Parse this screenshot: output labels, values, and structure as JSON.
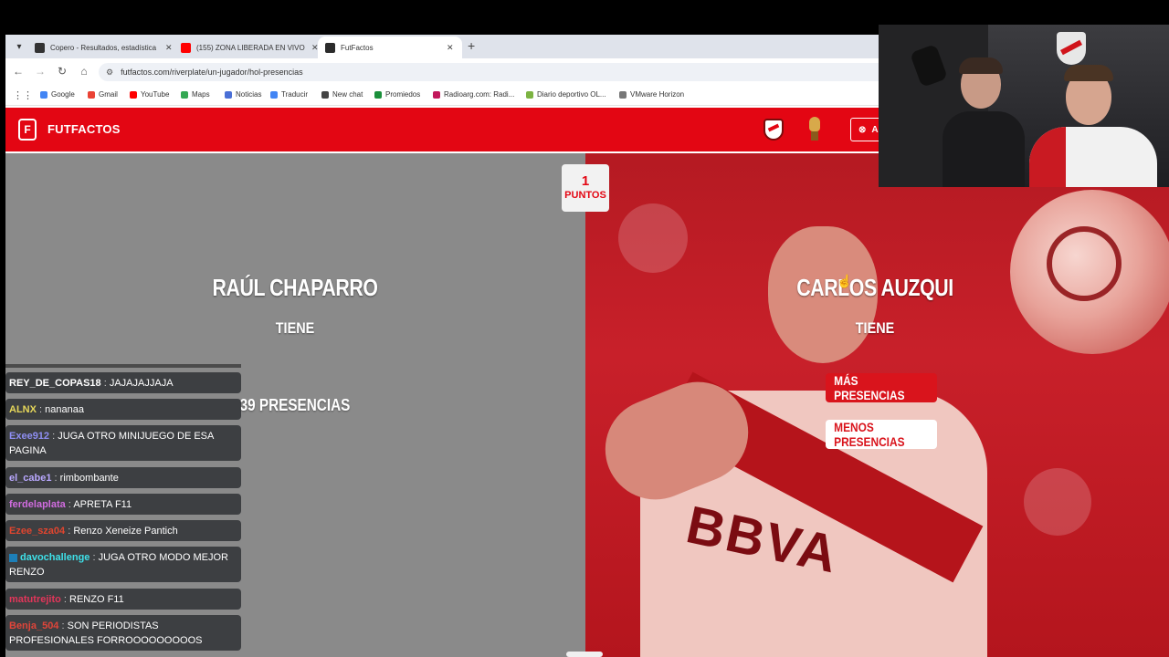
{
  "browser": {
    "tabs": [
      {
        "title": "Copero - Resultados, estadística",
        "fav_color": "#333333"
      },
      {
        "title": "(155) ZONA LIBERADA EN VIVO",
        "fav_color": "#ff0000"
      },
      {
        "title": "FutFactos",
        "fav_color": "#2b2b2b",
        "active": true
      }
    ],
    "url": "futfactos.com/riverplate/un-jugador/hol-presencias",
    "bookmarks": [
      {
        "label": "Google",
        "color": "#4285f4"
      },
      {
        "label": "Gmail",
        "color": "#ea4335"
      },
      {
        "label": "YouTube",
        "color": "#ff0000"
      },
      {
        "label": "Maps",
        "color": "#34a853"
      },
      {
        "label": "Noticias",
        "color": "#4a6fd6"
      },
      {
        "label": "Traducir",
        "color": "#4285f4"
      },
      {
        "label": "New chat",
        "color": "#444444"
      },
      {
        "label": "Promiedos",
        "color": "#1a8f3a"
      },
      {
        "label": "Radioarg.com: Radi...",
        "color": "#c2185b"
      },
      {
        "label": "Diario deportivo OL...",
        "color": "#7cb342"
      },
      {
        "label": "VMware Horizon",
        "color": "#777777"
      }
    ]
  },
  "site": {
    "logo": "FUTFACTOS",
    "account_label": "A"
  },
  "game": {
    "points_value": "1",
    "points_label": "PUNTOS",
    "left_player": {
      "name": "RAÚL CHAPARRO",
      "verb": "TIENE",
      "count": "39 PRESENCIAS"
    },
    "right_player": {
      "name": "CARLOS AUZQUI",
      "verb": "TIENE"
    },
    "more_label": "MÁS PRESENCIAS",
    "less_label": "MENOS PRESENCIAS",
    "sponsor": "BBVA"
  },
  "chat": [
    {
      "user": "REY_DE_COPAS18",
      "color": "#ffffff",
      "text": "JAJAJAJJAJA"
    },
    {
      "user": "ALNX",
      "color": "#e6d75a",
      "text": "nananaa"
    },
    {
      "user": "Exee912",
      "color": "#8e8ef2",
      "text": "JUGA OTRO MINIJUEGO DE ESA PAGINA"
    },
    {
      "user": "el_cabe1",
      "color": "#b9a8ff",
      "text": "rimbombante"
    },
    {
      "user": "ferdelaplata",
      "color": "#d16ce0",
      "text": "APRETA F11"
    },
    {
      "user": "Ezee_sza04",
      "color": "#e0452f",
      "text": "Renzo Xeneize Pantich"
    },
    {
      "user": "davochallenge",
      "color": "#3ee0e8",
      "text": "JUGA OTRO MODO MEJOR RENZO",
      "badge": true
    },
    {
      "user": "matutrejito",
      "color": "#e2365a",
      "text": "RENZO F11"
    },
    {
      "user": "Benja_504",
      "color": "#e0453a",
      "text": "SON PERIODISTAS PROFESIONALES FORROOOOOOOOOS"
    }
  ]
}
